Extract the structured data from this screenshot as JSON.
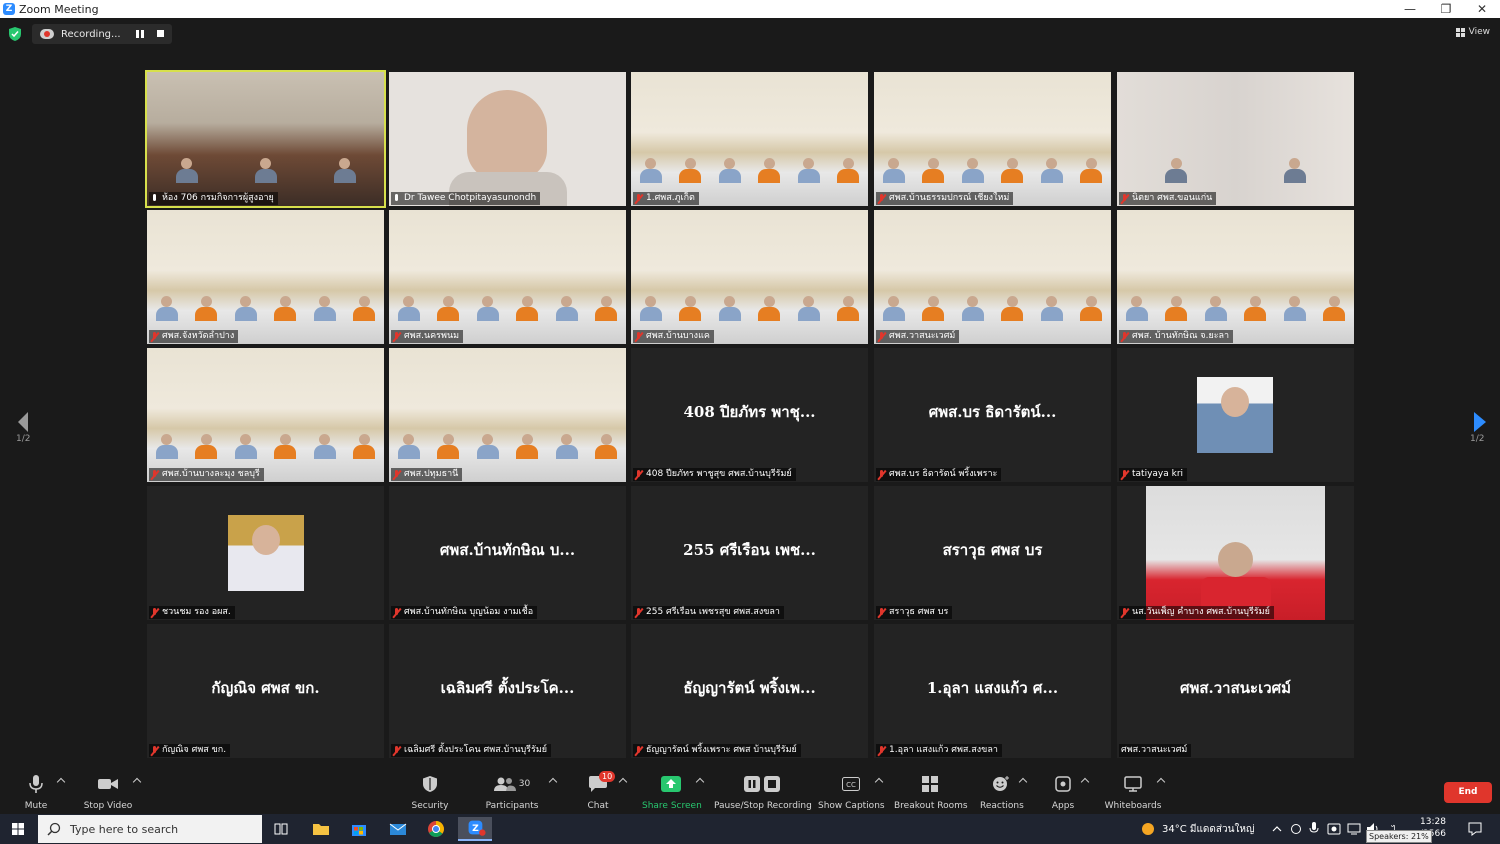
{
  "window": {
    "title": "Zoom Meeting",
    "minimize": "—",
    "restore": "❐",
    "close": "✕"
  },
  "top": {
    "recording_label": "Recording...",
    "view_label": "View"
  },
  "pager": {
    "left_label": "1/2",
    "right_label": "1/2"
  },
  "tiles": [
    {
      "display": "video",
      "name": "ห้อง 706 กรมกิจการผู้สูงอายุ",
      "mic": "live",
      "active": true,
      "scene": "meeting-room"
    },
    {
      "display": "video",
      "name": "Dr Tawee Chotpitayasunondh",
      "mic": "live",
      "scene": "portrait"
    },
    {
      "display": "video",
      "name": "1.ศพส.ภูเก็ต",
      "mic": "muted",
      "scene": "hall"
    },
    {
      "display": "video",
      "name": "ศพส.บ้านธรรมปกรณ์ เชียงใหม่",
      "mic": "muted",
      "scene": "hall"
    },
    {
      "display": "video",
      "name": "นิตยา ศพส.ขอนแก่น",
      "mic": "muted",
      "scene": "two-people"
    },
    {
      "display": "video",
      "name": "ศพส.จังหวัดลำปาง",
      "mic": "muted",
      "scene": "hall"
    },
    {
      "display": "video",
      "name": "ศพส.นครพนม",
      "mic": "muted",
      "scene": "hall"
    },
    {
      "display": "video",
      "name": "ศพส.บ้านบางแค",
      "mic": "muted",
      "scene": "hall"
    },
    {
      "display": "video",
      "name": "ศพส.วาสนะเวศม์",
      "mic": "muted",
      "scene": "hall"
    },
    {
      "display": "video",
      "name": "ศพส. บ้านทักษิณ จ.ยะลา",
      "mic": "muted",
      "scene": "hall"
    },
    {
      "display": "video",
      "name": "ศพส.บ้านบางละมุง ชลบุรี",
      "mic": "muted",
      "scene": "hall"
    },
    {
      "display": "video",
      "name": "ศพส.ปทุมธานี",
      "mic": "muted",
      "scene": "hall"
    },
    {
      "display": "name",
      "big": "408 ปียภัทร  พาชุ...",
      "name": "408 ปียภัทร  พาชูสุข  ศพส.บ้านบุรีรัมย์",
      "mic": "muted"
    },
    {
      "display": "name",
      "big": "ศพส.บร ธิดารัตน์...",
      "name": "ศพส.บร ธิดารัตน์ พริ้งเพราะ",
      "mic": "muted"
    },
    {
      "display": "avatar",
      "name": "tatiyaya kri",
      "mic": "muted",
      "scene": "avatar-woman"
    },
    {
      "display": "avatar",
      "name": "ชวนชม  รอง อผส.",
      "mic": "muted",
      "scene": "avatar-official"
    },
    {
      "display": "name",
      "big": "ศพส.บ้านทักษิณ บ...",
      "name": "ศพส.บ้านทักษิณ บุญน้อม งามเชื้อ",
      "mic": "muted"
    },
    {
      "display": "name",
      "big": "255 ศรีเรือน เพช...",
      "name": "255 ศรีเรือน เพชรสุข ศพส.สงขลา",
      "mic": "muted"
    },
    {
      "display": "name",
      "big": "สราวุธ ศพส บร",
      "name": "สราวุธ ศพส บร",
      "mic": "muted"
    },
    {
      "display": "video",
      "name": "นส.วันเพ็ญ คำบาง ศพส.บ้านบุรีรัมย์",
      "mic": "muted",
      "scene": "red-shirt"
    },
    {
      "display": "name",
      "big": "กัญณิจ ศพส ขก.",
      "name": "กัญณิจ ศพส ขก.",
      "mic": "muted"
    },
    {
      "display": "name",
      "big": "เฉลิมศรี ตั้งประโค...",
      "name": "เฉลิมศรี ตั้งประโคน ศพส.บ้านบุรีรัมย์",
      "mic": "muted"
    },
    {
      "display": "name",
      "big": "ธัญญารัตน์ พริ้งเพ...",
      "name": "ธัญญารัตน์ พริ้งเพราะ ศพส บ้านบุรีรัมย์",
      "mic": "muted"
    },
    {
      "display": "name",
      "big": "1.อุลา แสงแก้ว ศ...",
      "name": "1.อุลา แสงแก้ว ศพส.สงขลา",
      "mic": "muted"
    },
    {
      "display": "name",
      "big": "ศพส.วาสนะเวศม์",
      "name": "ศพส.วาสนะเวศม์",
      "mic": "none"
    }
  ],
  "toolbar": {
    "mute": "Mute",
    "stop_video": "Stop Video",
    "security": "Security",
    "participants": "Participants",
    "participants_count": "30",
    "chat": "Chat",
    "chat_badge": "10",
    "share_screen": "Share Screen",
    "recording": "Pause/Stop Recording",
    "captions": "Show Captions",
    "breakout": "Breakout Rooms",
    "reactions": "Reactions",
    "apps": "Apps",
    "whiteboards": "Whiteboards",
    "end": "End"
  },
  "taskbar": {
    "search_placeholder": "Type here to search",
    "weather": "34°C  มีแดดส่วนใหญ่",
    "time": "13:28",
    "date": "/2566",
    "speaker_tip": "Speakers: 21%"
  },
  "colors": {
    "active_speaker": "#d7e04c",
    "end": "#e0362c",
    "share": "#28c76f"
  }
}
